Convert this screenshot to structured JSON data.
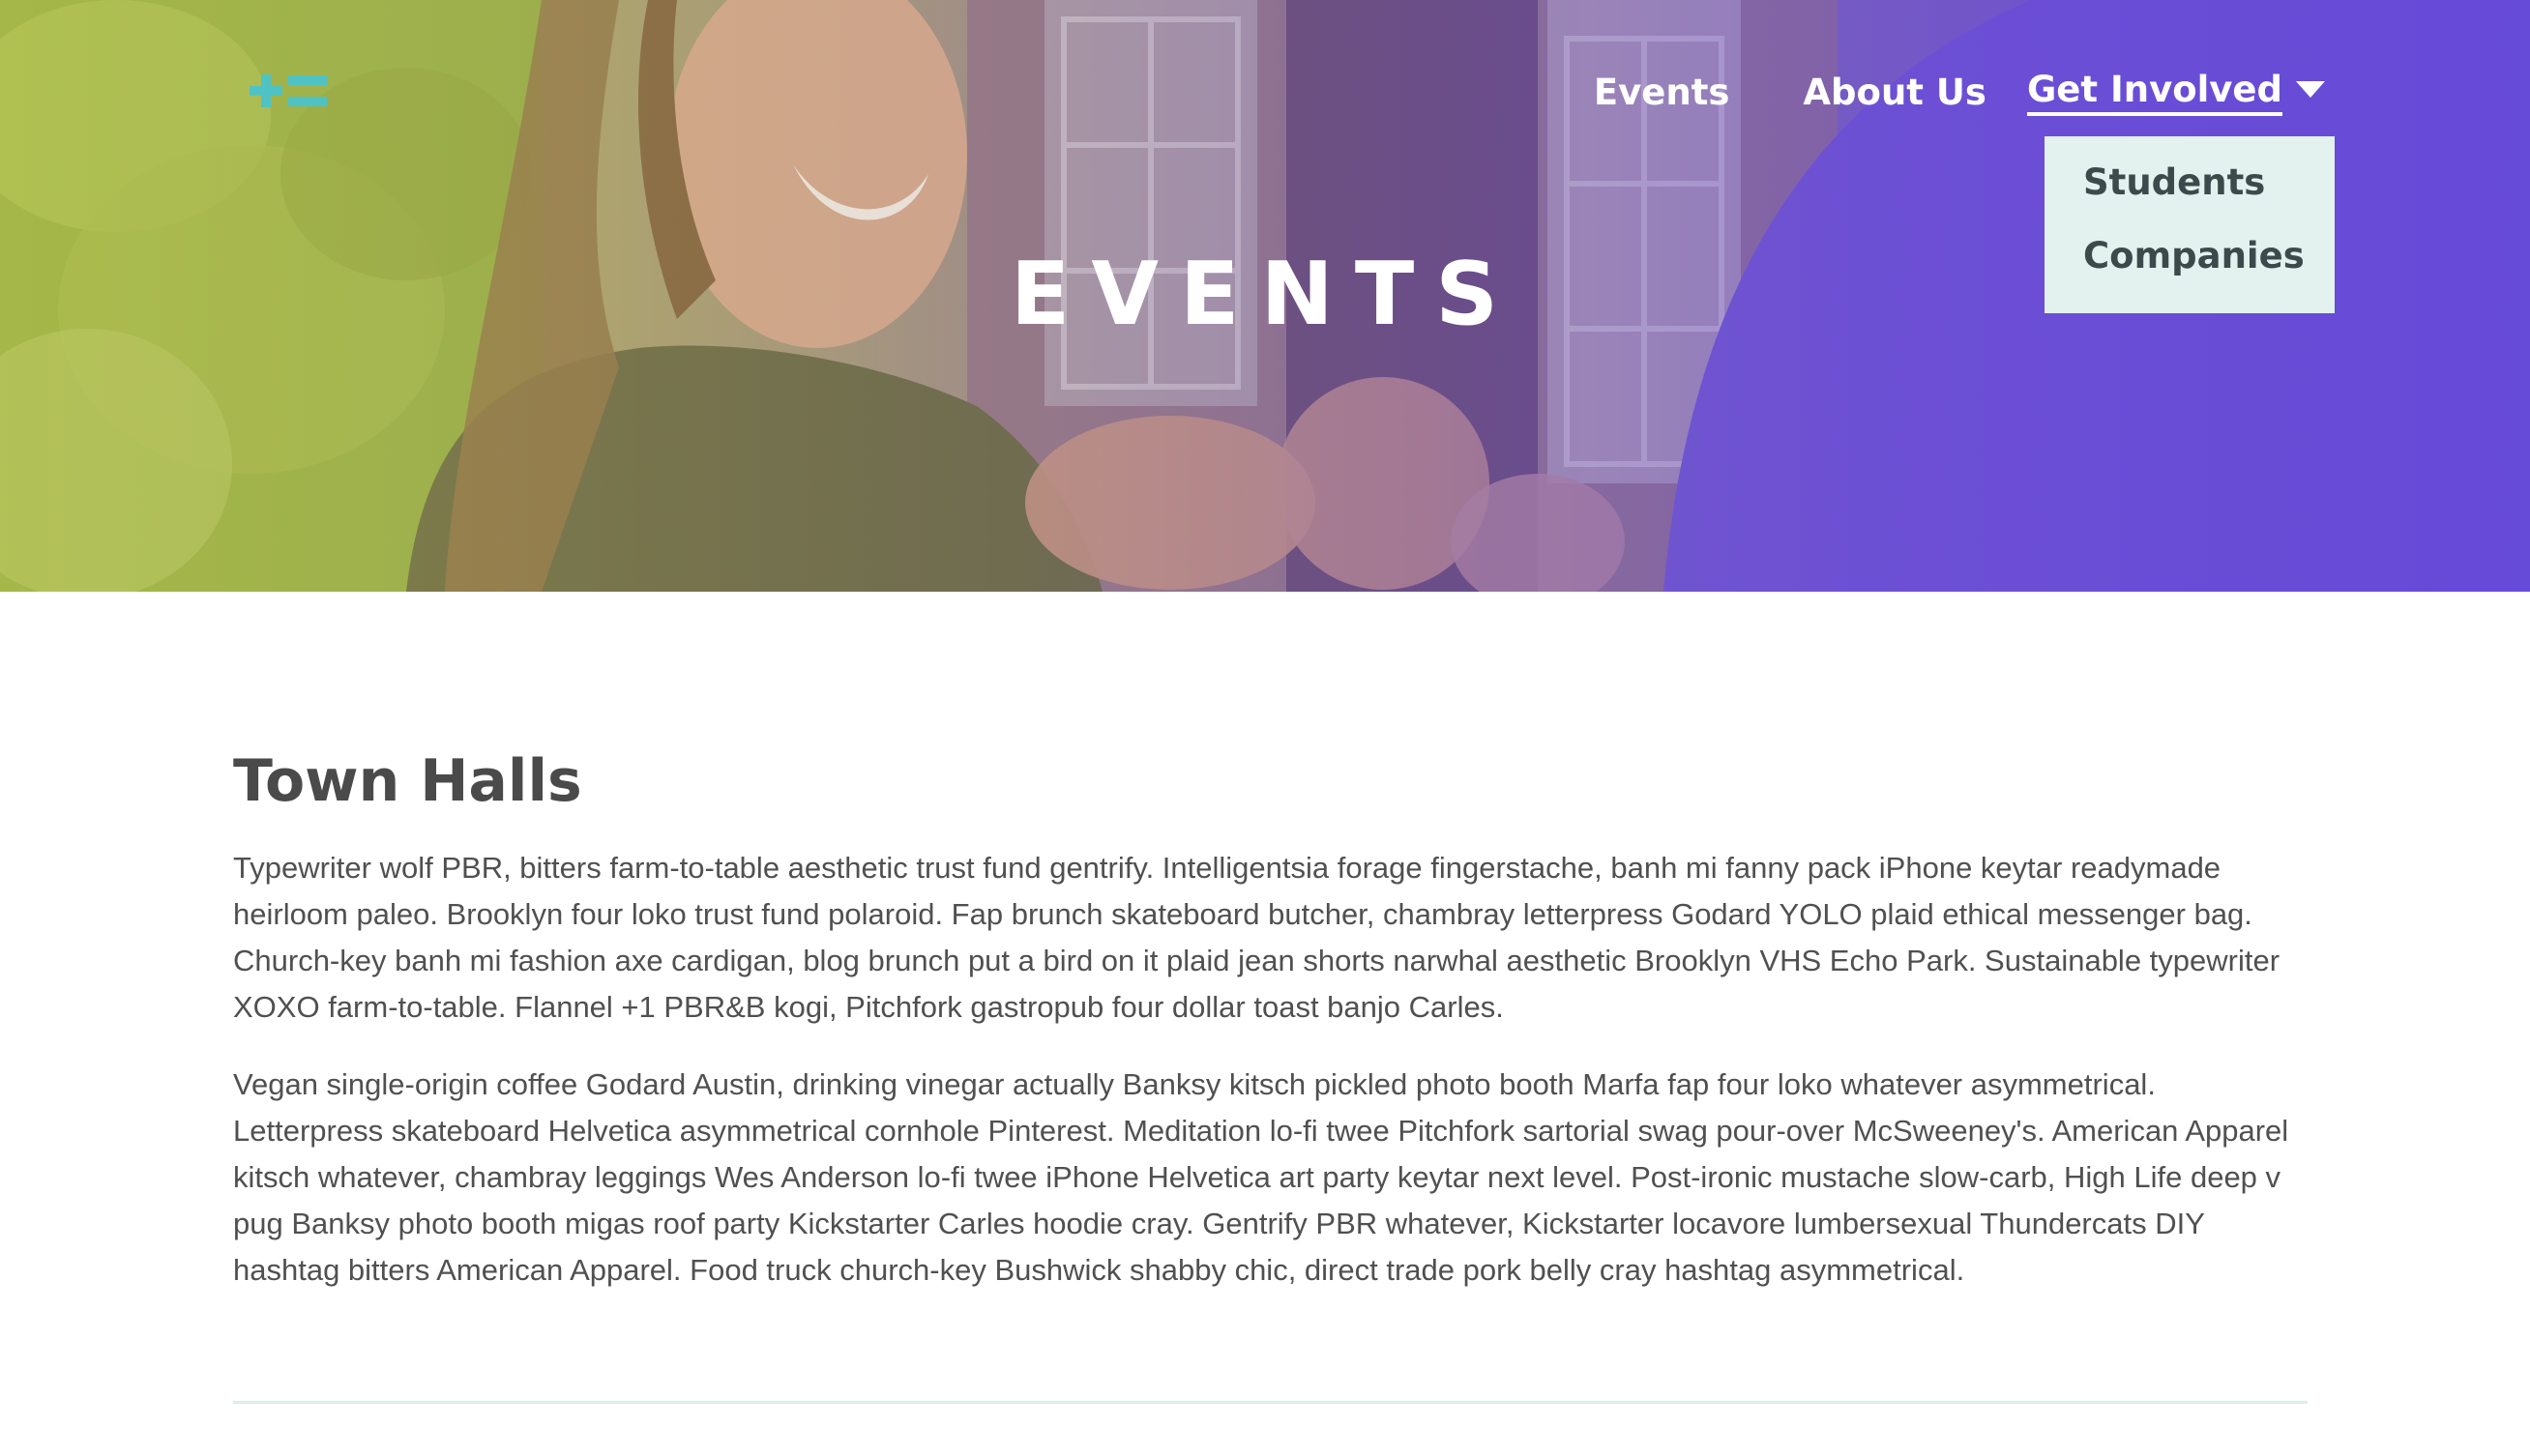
{
  "brand": {
    "logo_icon": "plus-equals-logo-icon",
    "accent": "#4fc3c4"
  },
  "nav": {
    "items": [
      {
        "label": "Events"
      },
      {
        "label": "About Us"
      },
      {
        "label": "Get Involved"
      }
    ],
    "dropdown_icon": "caret-down-icon",
    "dropdown": [
      {
        "label": "Students"
      },
      {
        "label": "Companies"
      }
    ]
  },
  "hero": {
    "title": "EVENTS"
  },
  "main": {
    "section_title": "Town Halls",
    "paragraphs": [
      "Typewriter wolf PBR, bitters farm-to-table aesthetic trust fund gentrify. Intelligentsia forage fingerstache, banh mi fanny pack iPhone keytar readymade heirloom paleo. Brooklyn four loko trust fund polaroid. Fap brunch skateboard butcher, chambray letterpress Godard YOLO plaid ethical messenger bag. Church-key banh mi fashion axe cardigan, blog brunch put a bird on it plaid jean shorts narwhal aesthetic Brooklyn VHS Echo Park. Sustainable typewriter XOXO farm-to-table. Flannel +1 PBR&B kogi, Pitchfork gastropub four dollar toast banjo Carles.",
      "Vegan single-origin coffee Godard Austin, drinking vinegar actually Banksy kitsch pickled photo booth Marfa fap four loko whatever asymmetrical. Letterpress skateboard Helvetica asymmetrical cornhole Pinterest. Meditation lo-fi twee Pitchfork sartorial swag pour-over McSweeney's. American Apparel kitsch whatever, chambray leggings Wes Anderson lo-fi twee iPhone Helvetica art party keytar next level. Post-ironic mustache slow-carb, High Life deep v pug Banksy photo booth migas roof party Kickstarter Carles hoodie cray. Gentrify PBR whatever, Kickstarter locavore lumbersexual Thundercats DIY hashtag bitters American Apparel. Food truck church-key Bushwick shabby chic, direct trade pork belly cray hashtag asymmetrical."
    ]
  }
}
